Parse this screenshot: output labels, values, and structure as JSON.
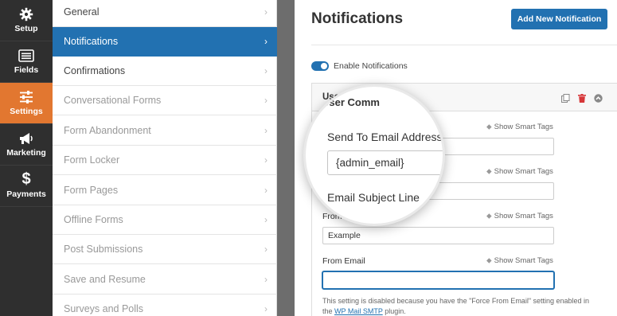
{
  "rail": {
    "items": [
      {
        "label": "Setup",
        "icon": "gear-icon"
      },
      {
        "label": "Fields",
        "icon": "fields-icon"
      },
      {
        "label": "Settings",
        "icon": "sliders-icon"
      },
      {
        "label": "Marketing",
        "icon": "megaphone-icon"
      },
      {
        "label": "Payments",
        "icon": "dollar-icon"
      }
    ],
    "active_color": "#e27730"
  },
  "sections": {
    "items": [
      {
        "label": "General"
      },
      {
        "label": "Notifications"
      },
      {
        "label": "Confirmations"
      },
      {
        "label": "Conversational Forms"
      },
      {
        "label": "Form Abandonment"
      },
      {
        "label": "Form Locker"
      },
      {
        "label": "Form Pages"
      },
      {
        "label": "Offline Forms"
      },
      {
        "label": "Post Submissions"
      },
      {
        "label": "Save and Resume"
      },
      {
        "label": "Surveys and Polls"
      }
    ],
    "chevron": "›"
  },
  "main": {
    "title": "Notifications",
    "add_button": "Add New Notification",
    "enable_label": "Enable Notifications",
    "enable_on": true,
    "panel": {
      "title_partial": "User",
      "fields": [
        {
          "label": "",
          "value": "",
          "smart": "Show Smart Tags"
        },
        {
          "label": "",
          "value": "",
          "smart": "Show Smart Tags"
        },
        {
          "label": "From Name",
          "label_shown": "From N",
          "value": "Example",
          "smart": "Show Smart Tags"
        },
        {
          "label": "From Email",
          "value": "",
          "smart": "Show Smart Tags"
        }
      ],
      "note_text": "This setting is disabled because you have the \"Force From Email\" setting enabled in the ",
      "note_link": "WP Mail SMTP",
      "note_end": " plugin."
    }
  },
  "magnifier": {
    "title_fragment": "Comm",
    "label_send_to": "Send To Email Address",
    "send_to_value": "{admin_email}",
    "label_subject": "Email Subject Line"
  },
  "colors": {
    "accent": "#2271b1",
    "rail_bg": "#2f2f2f",
    "delete": "#d63638"
  }
}
